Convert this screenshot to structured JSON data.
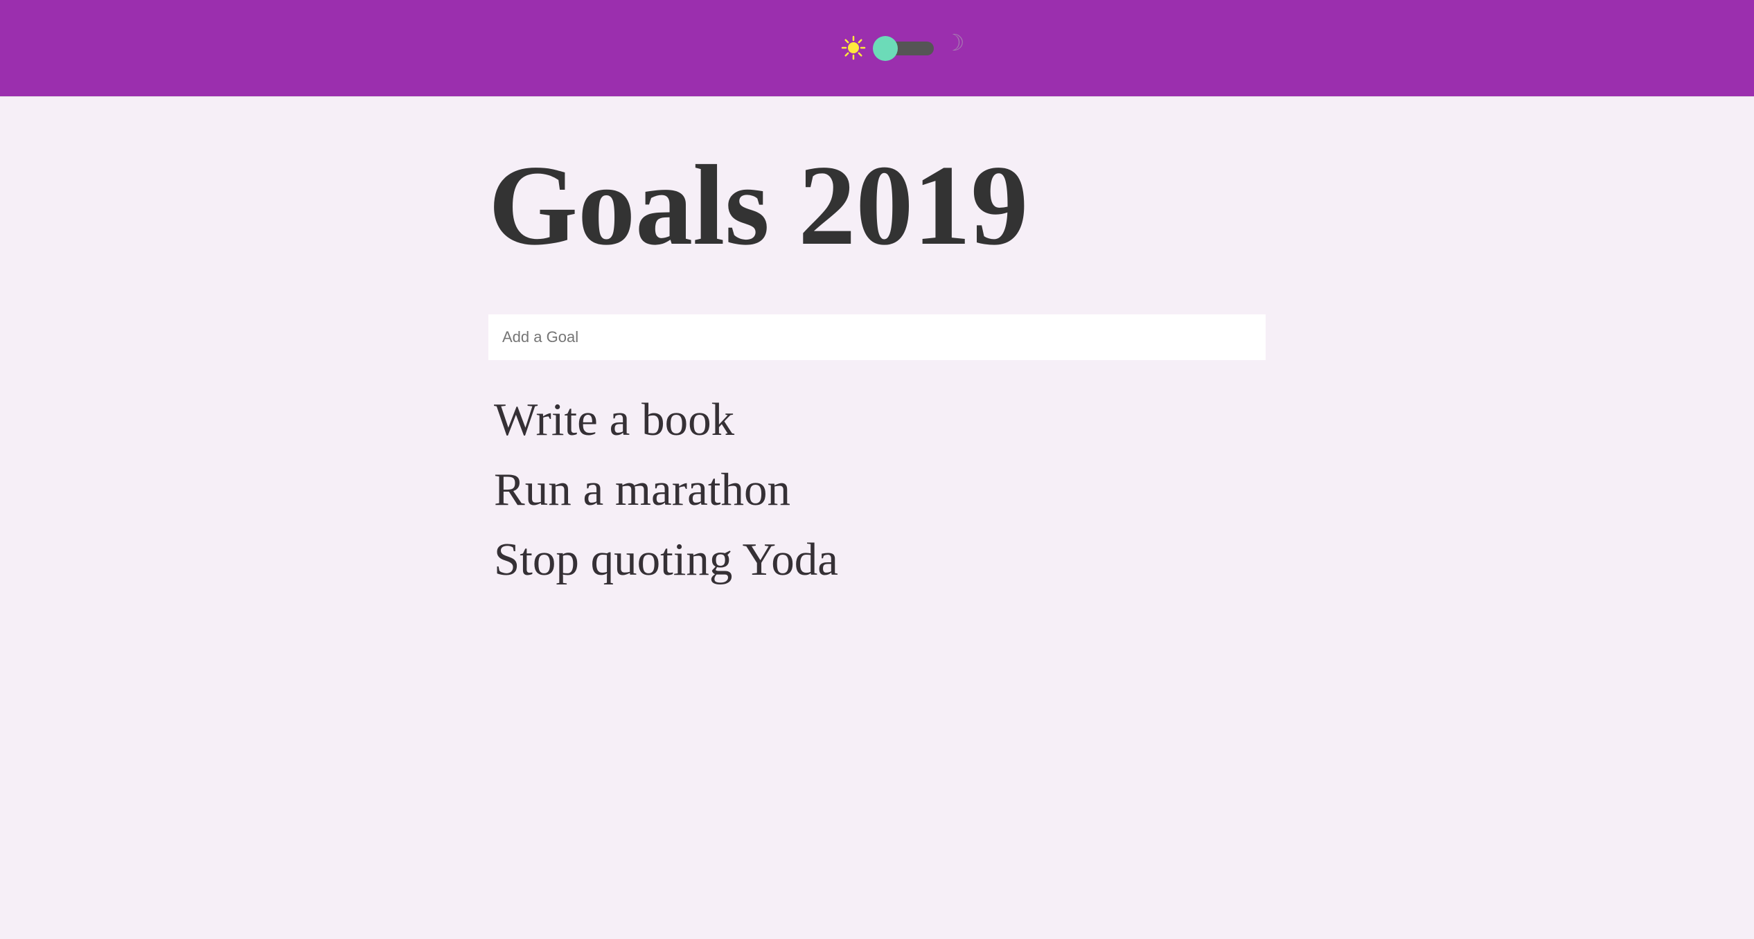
{
  "header": {
    "theme_toggle": {
      "sun_icon": "sun-icon",
      "moon_icon": "moon-icon",
      "moon_glyph": "☽",
      "state": "light"
    },
    "background_color": "#9b2fae"
  },
  "main": {
    "title": "Goals 2019",
    "input": {
      "placeholder": "Add a Goal",
      "value": ""
    },
    "goals": [
      {
        "label": "Write a book"
      },
      {
        "label": "Run a marathon"
      },
      {
        "label": "Stop quoting Yoda"
      }
    ]
  },
  "colors": {
    "page_background": "#f6eff7",
    "title_text": "#333333",
    "toggle_thumb": "#6cdbb8",
    "toggle_track": "#555555",
    "sun": "#ffe93d"
  }
}
